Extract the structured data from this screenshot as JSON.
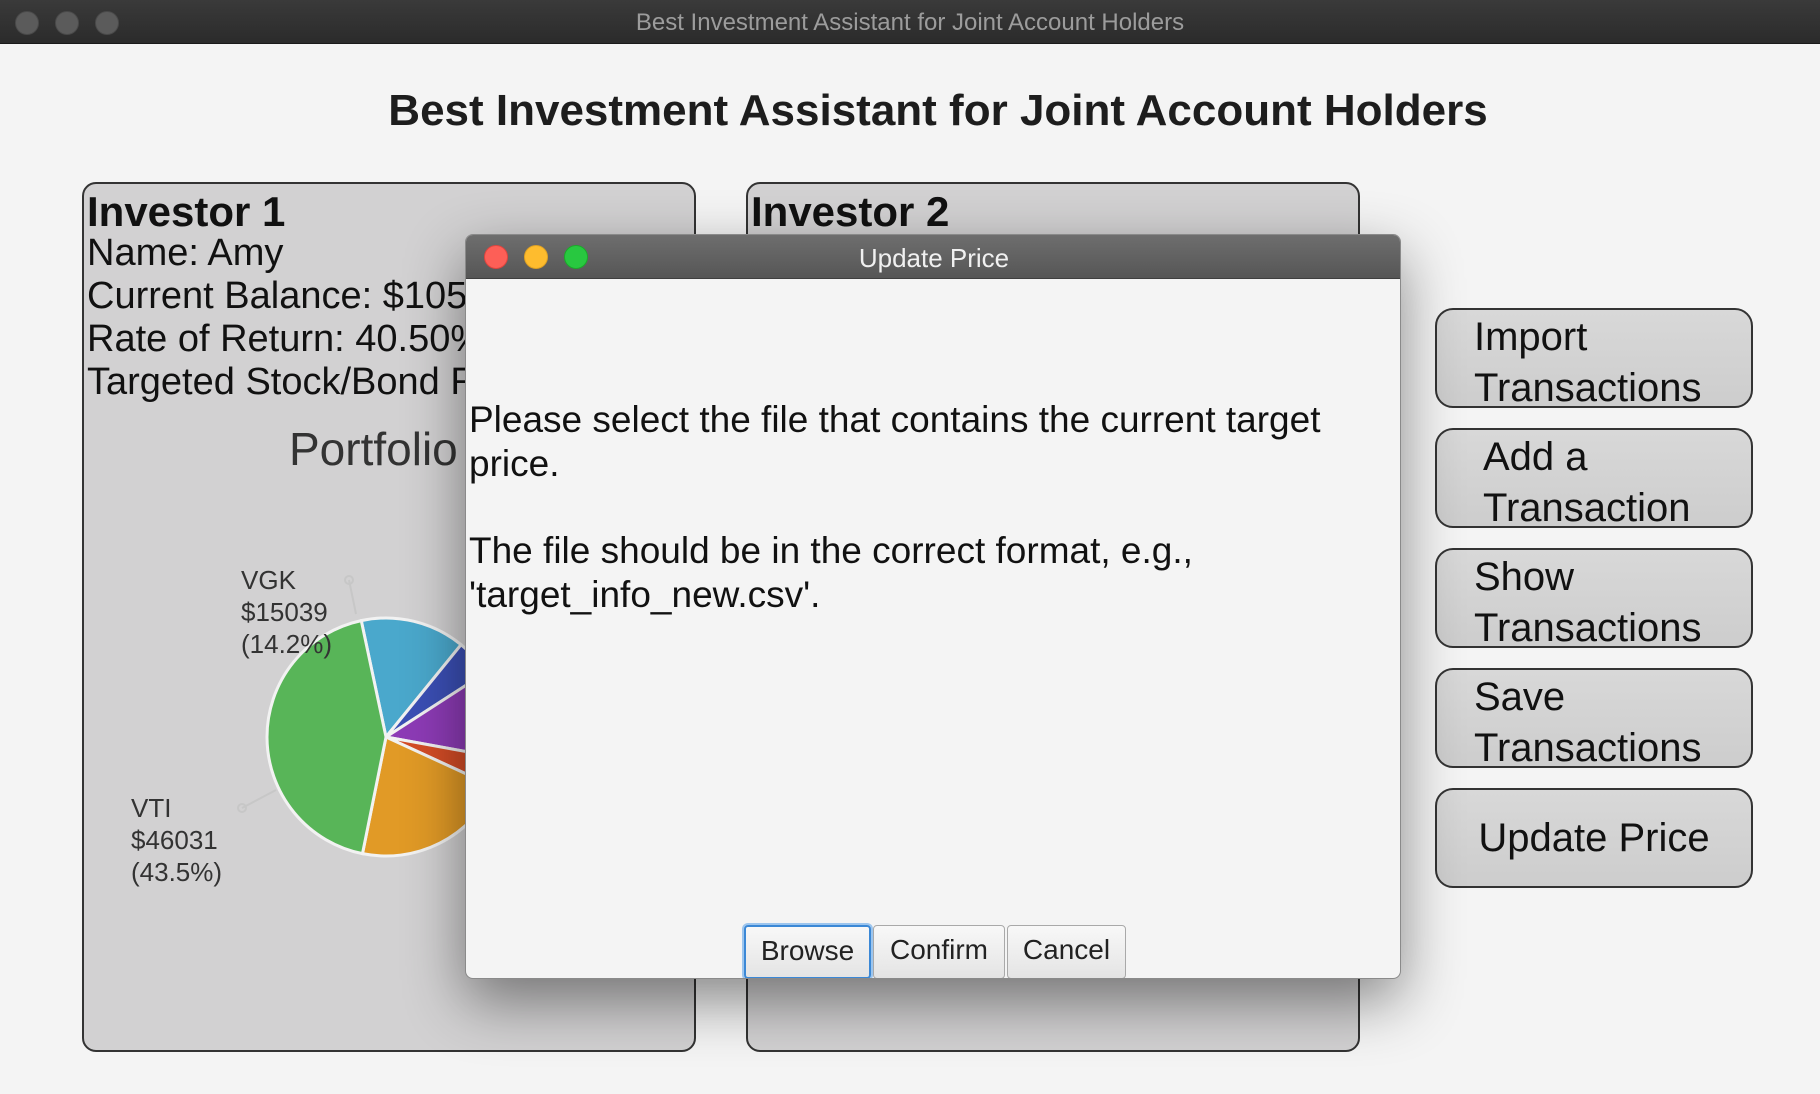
{
  "window": {
    "title": "Best Investment Assistant for Joint Account Holders"
  },
  "app": {
    "heading": "Best Investment Assistant for Joint Account Holders"
  },
  "investor1": {
    "title": "Investor 1",
    "name": "Name: Amy",
    "balance": "Current Balance: $105",
    "rate_of_return": "Rate of Return: 40.50%",
    "ratio": "Targeted Stock/Bond R",
    "chart_title": "Portfolio",
    "labels": {
      "vgk": {
        "ticker": "VGK",
        "value": "$15039",
        "pct": "(14.2%)"
      },
      "vti": {
        "ticker": "VTI",
        "value": "$46031",
        "pct": "(43.5%)"
      }
    }
  },
  "investor2": {
    "title": "Investor 2"
  },
  "side_buttons": {
    "import": [
      "Import",
      "Transactions"
    ],
    "add": [
      "Add a",
      "Transaction"
    ],
    "show": [
      "Show",
      "Transactions"
    ],
    "save": [
      "Save",
      "Transactions"
    ],
    "update": "Update Price"
  },
  "dialog": {
    "title": "Update Price",
    "message1": "Please select the file that contains the current target price.",
    "message2": "The file should be in the correct format, e.g., 'target_info_new.csv'.",
    "buttons": {
      "browse": "Browse",
      "confirm": "Confirm",
      "cancel": "Cancel"
    }
  },
  "chart_data": {
    "type": "pie",
    "title": "Portfolio",
    "slices": [
      {
        "name": "VGK",
        "value": 15039,
        "percent": 14.2,
        "color": "#4aa8cc"
      },
      {
        "name": "",
        "value": null,
        "percent": 5.0,
        "color": "#3b4fb5"
      },
      {
        "name": "",
        "value": null,
        "percent": 12.0,
        "color": "#8d3bb6"
      },
      {
        "name": "",
        "value": null,
        "percent": 4.0,
        "color": "#d44c26"
      },
      {
        "name": "",
        "value": null,
        "percent": 21.3,
        "color": "#e19a26"
      },
      {
        "name": "VTI",
        "value": 46031,
        "percent": 43.5,
        "color": "#58b558"
      }
    ]
  }
}
